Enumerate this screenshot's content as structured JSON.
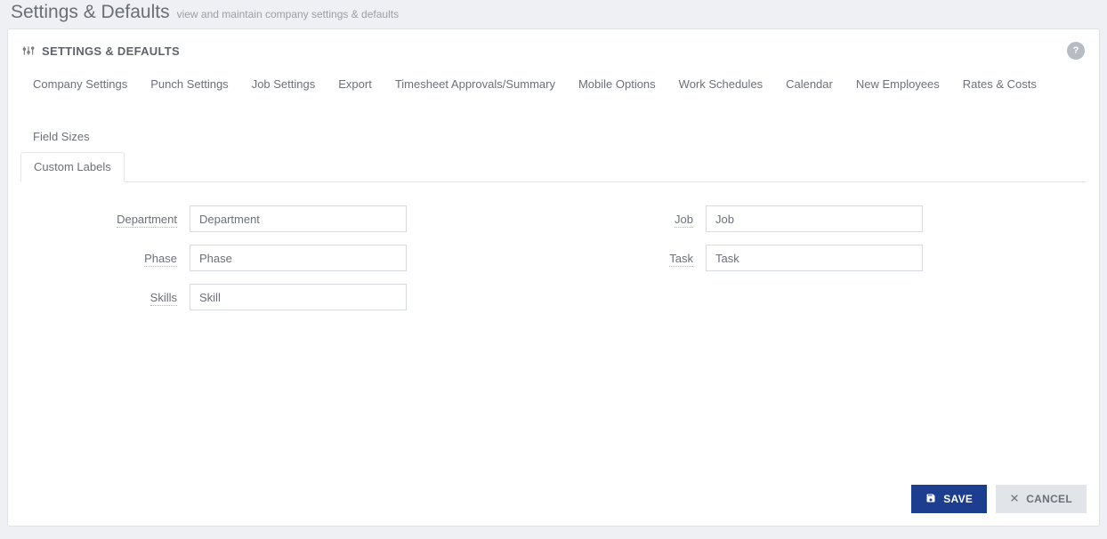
{
  "header": {
    "title": "Settings & Defaults",
    "subtitle": "view and maintain company settings & defaults"
  },
  "panel": {
    "title": "SETTINGS & DEFAULTS",
    "help_tooltip": "?"
  },
  "tabs": [
    "Company Settings",
    "Punch Settings",
    "Job Settings",
    "Export",
    "Timesheet Approvals/Summary",
    "Mobile Options",
    "Work Schedules",
    "Calendar",
    "New Employees",
    "Rates & Costs",
    "Field Sizes"
  ],
  "tabs2": {
    "active": "Custom Labels"
  },
  "form": {
    "left": [
      {
        "label": "Department",
        "value": "Department"
      },
      {
        "label": "Phase",
        "value": "Phase"
      },
      {
        "label": "Skills",
        "value": "Skill"
      }
    ],
    "right": [
      {
        "label": "Job",
        "value": "Job"
      },
      {
        "label": "Task",
        "value": "Task"
      }
    ]
  },
  "footer": {
    "save": "SAVE",
    "cancel": "CANCEL"
  }
}
